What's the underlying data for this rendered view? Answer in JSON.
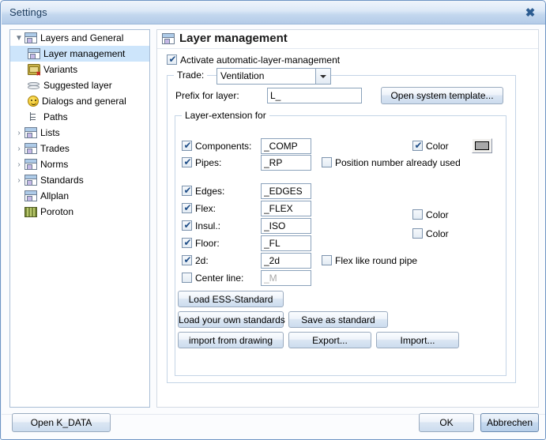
{
  "window": {
    "title": "Settings",
    "close_icon": "close-icon",
    "close_glyph": "✖"
  },
  "sidebar": {
    "items": [
      {
        "label": "Layers and General",
        "icon": "page-icon",
        "twisty": "▼",
        "indent": 0,
        "selected": false
      },
      {
        "label": "Layer management",
        "icon": "page-icon",
        "twisty": "",
        "indent": 1,
        "selected": true
      },
      {
        "label": "Variants",
        "icon": "folder-icon",
        "twisty": "",
        "indent": 1,
        "selected": false
      },
      {
        "label": "Suggested layer",
        "icon": "stack-icon",
        "twisty": "",
        "indent": 1,
        "selected": false
      },
      {
        "label": "Dialogs and general",
        "icon": "smiley-icon",
        "twisty": "",
        "indent": 1,
        "selected": false
      },
      {
        "label": "Paths",
        "icon": "tree-icon",
        "twisty": "",
        "indent": 1,
        "selected": false
      },
      {
        "label": "Lists",
        "icon": "page-icon",
        "twisty": "›",
        "indent": 0,
        "selected": false
      },
      {
        "label": "Trades",
        "icon": "page-icon",
        "twisty": "›",
        "indent": 0,
        "selected": false
      },
      {
        "label": "Norms",
        "icon": "page-icon",
        "twisty": "›",
        "indent": 0,
        "selected": false
      },
      {
        "label": "Standards",
        "icon": "page-icon",
        "twisty": "›",
        "indent": 0,
        "selected": false
      },
      {
        "label": "Allplan",
        "icon": "page-icon",
        "twisty": "",
        "indent": 0,
        "selected": false
      },
      {
        "label": "Poroton",
        "icon": "poroton-icon",
        "twisty": "",
        "indent": 0,
        "selected": false
      }
    ]
  },
  "panel": {
    "header_title": "Layer management",
    "header_icon": "page-icon",
    "activate_checkbox": {
      "label": "Activate automatic-layer-management",
      "checked": true
    },
    "trade_group_title": "Trade:",
    "trade_combo": {
      "value": "Ventilation",
      "arrow": "▼"
    },
    "prefix_label": "Prefix for layer:",
    "prefix_input": {
      "value": "L_"
    },
    "open_system_template_button": "Open system template...",
    "layer_extension_group_title": "Layer-extension for",
    "rows": [
      {
        "name": "components",
        "label": "Components:",
        "checked": true,
        "value": "_COMP",
        "disabled": false
      },
      {
        "name": "pipes",
        "label": "Pipes:",
        "checked": true,
        "value": "_RP",
        "disabled": false
      },
      {
        "name": "edges",
        "label": "Edges:",
        "checked": true,
        "value": "_EDGES",
        "disabled": false
      },
      {
        "name": "flex",
        "label": "Flex:",
        "checked": true,
        "value": "_FLEX",
        "disabled": false
      },
      {
        "name": "insul",
        "label": "Insul.:",
        "checked": true,
        "value": "_ISO",
        "disabled": false
      },
      {
        "name": "floor",
        "label": "Floor:",
        "checked": true,
        "value": "_FL",
        "disabled": false
      },
      {
        "name": "2d",
        "label": "2d:",
        "checked": true,
        "value": "_2d",
        "disabled": false
      },
      {
        "name": "center-line",
        "label": "Center line:",
        "checked": false,
        "value": "_M",
        "disabled": true
      }
    ],
    "color_components": {
      "label": "Color",
      "checked": true
    },
    "color_flex": {
      "label": "Color",
      "checked": false
    },
    "color_insul": {
      "label": "Color",
      "checked": false
    },
    "position_number_checkbox": {
      "label": "Position number already used",
      "checked": false
    },
    "flex_like_round_pipe_checkbox": {
      "label": "Flex like round pipe",
      "checked": false
    },
    "color_swatch": {
      "name": "color-swatch-button",
      "color": "#a8a8a8"
    },
    "buttons": {
      "load_ess_standard": "Load ESS-Standard",
      "load_your_own_standards": "Load your own standards",
      "save_as_standard": "Save as standard",
      "import_from_drawing": "import from drawing",
      "export": "Export...",
      "import": "Import..."
    }
  },
  "footer": {
    "open_k_data": "Open K_DATA",
    "ok": "OK",
    "cancel": "Abbrechen"
  }
}
